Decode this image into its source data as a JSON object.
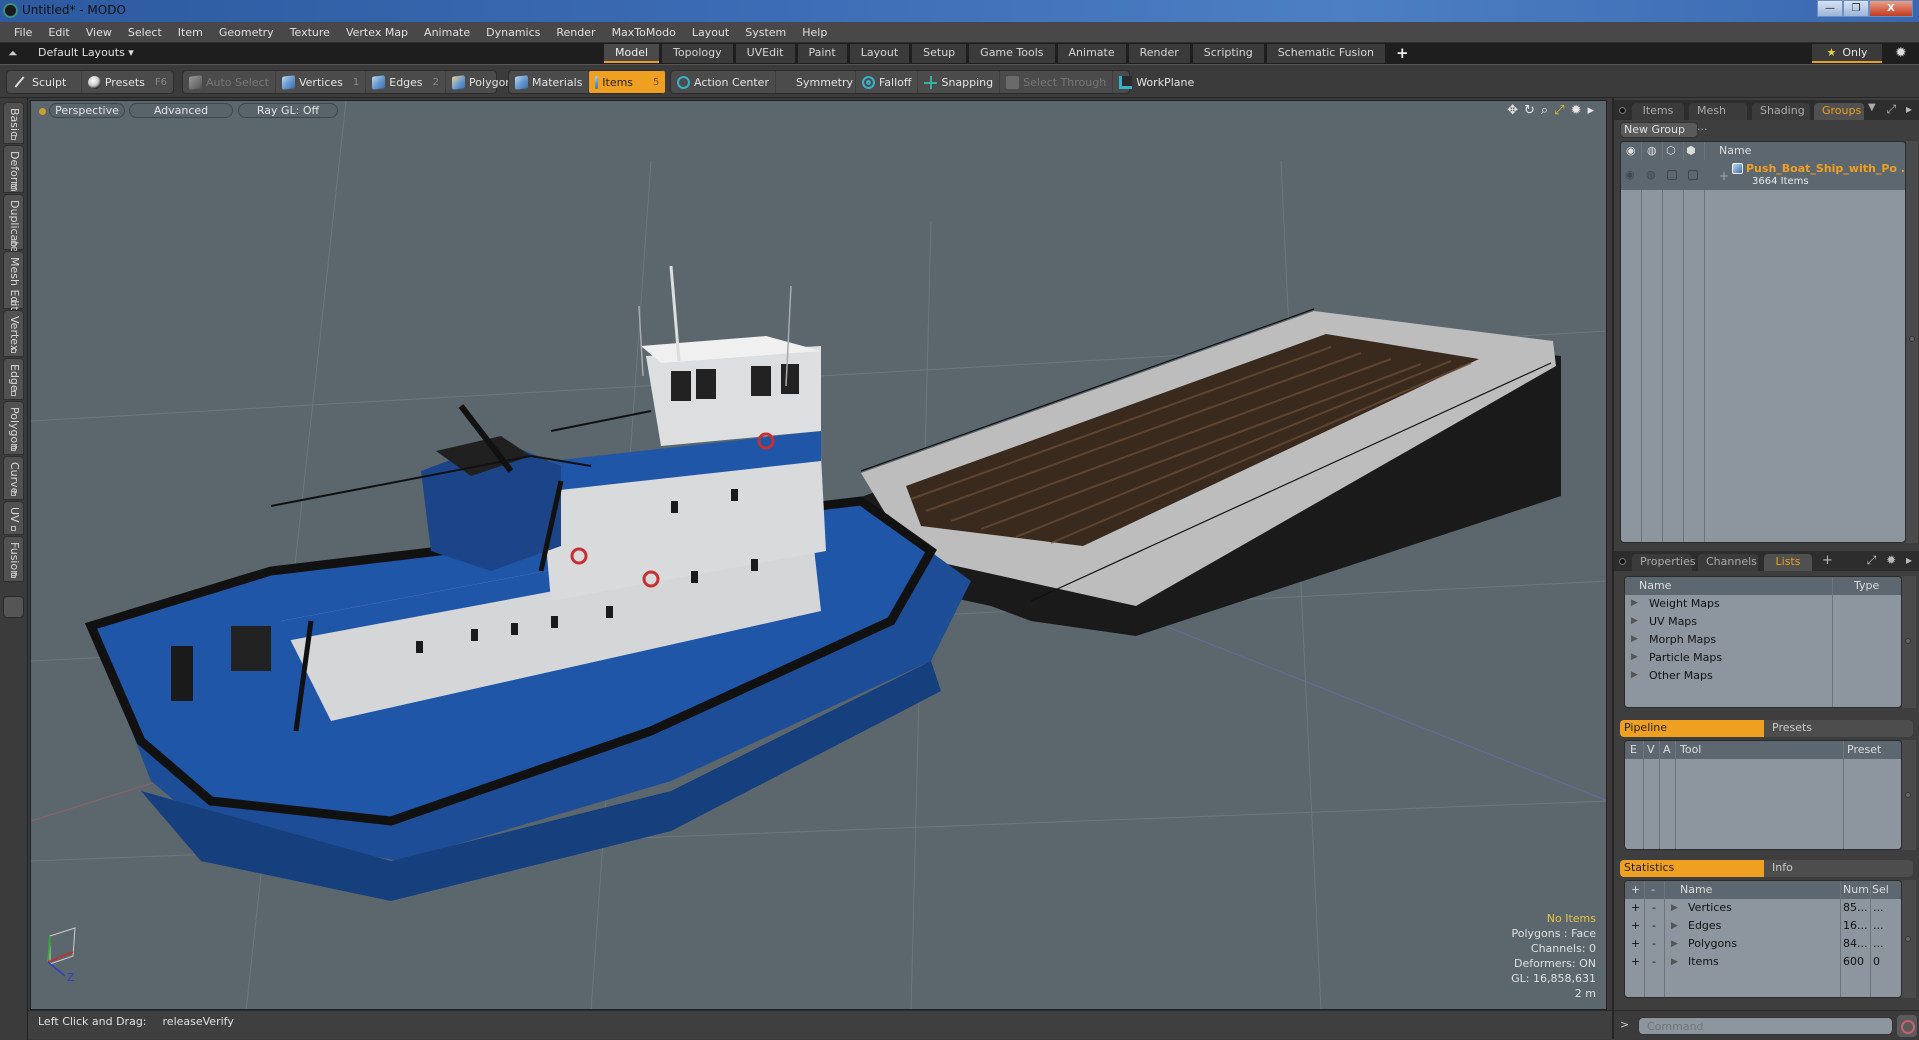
{
  "window": {
    "title": "Untitled* - MODO",
    "controls": [
      "minimize",
      "restore",
      "close"
    ]
  },
  "menubar": {
    "items": [
      "File",
      "Edit",
      "View",
      "Select",
      "Item",
      "Geometry",
      "Texture",
      "Vertex Map",
      "Animate",
      "Dynamics",
      "Render",
      "MaxToModo",
      "Layout",
      "System",
      "Help"
    ]
  },
  "layoutbar": {
    "layouts_dropdown": "Default Layouts ▾",
    "tabs": [
      {
        "label": "Model",
        "active": true
      },
      {
        "label": "Topology"
      },
      {
        "label": "UVEdit"
      },
      {
        "label": "Paint"
      },
      {
        "label": "Layout"
      },
      {
        "label": "Setup"
      },
      {
        "label": "Game Tools"
      },
      {
        "label": "Animate"
      },
      {
        "label": "Render"
      },
      {
        "label": "Scripting"
      },
      {
        "label": "Schematic Fusion"
      }
    ],
    "add_tab": "+",
    "only_label": "Only",
    "only_star": "★"
  },
  "toolbar": {
    "sculpt": "Sculpt",
    "presets": "Presets",
    "presets_key": "F6",
    "auto_select": "Auto Select",
    "vertices": "Vertices",
    "vertices_key": "1",
    "edges": "Edges",
    "edges_key": "2",
    "polygons": "Polygons",
    "materials": "Materials",
    "items": "Items",
    "items_key": "5",
    "action_center": "Action Center",
    "symmetry": "Symmetry",
    "falloff": "Falloff",
    "snapping": "Snapping",
    "select_through": "Select Through",
    "workplane": "WorkPlane",
    "active_mode": "Items"
  },
  "left_tabs": [
    "Basic",
    "Deform",
    "Duplicate",
    "Mesh Edit",
    "Vertex",
    "Edge",
    "Polygon",
    "Curve",
    "UV",
    "Fusion"
  ],
  "viewport": {
    "view": "Perspective",
    "shading": "Advanced",
    "raygl": "Ray GL: Off",
    "info": {
      "selection": "No Items",
      "mode": "Polygons : Face",
      "channels": "Channels: 0",
      "deformers": "Deformers: ON",
      "gl": "GL: 16,858,631",
      "scale": "2 m"
    },
    "axis_label": "Z",
    "scene_description": "Push boat (blue/white tug) with barge loaded with timber"
  },
  "statusbar": {
    "hint_label": "Left Click and Drag:",
    "hint_value": "releaseVerify"
  },
  "right_panel": {
    "top_tabs": [
      {
        "label": "Items"
      },
      {
        "label": "Mesh ..."
      },
      {
        "label": "Shading"
      },
      {
        "label": "Groups",
        "active": true
      }
    ],
    "new_group": "New Group",
    "groups_columns": [
      "Name"
    ],
    "groups": [
      {
        "name": "Push_Boat_Ship_with_Po ...",
        "count": "3664 Items"
      }
    ],
    "mid_tabs": [
      {
        "label": "Properties"
      },
      {
        "label": "Channels"
      },
      {
        "label": "Lists",
        "active": true
      }
    ],
    "lists_columns": [
      "Name",
      "Type"
    ],
    "lists": [
      "Weight Maps",
      "UV Maps",
      "Morph Maps",
      "Particle Maps",
      "Other Maps"
    ],
    "pipeline_tabs": [
      {
        "label": "Pipeline",
        "active": true
      },
      {
        "label": "Presets"
      }
    ],
    "pipeline_columns": [
      "E",
      "V",
      "A",
      "Tool",
      "Preset"
    ],
    "stats_tabs": [
      {
        "label": "Statistics",
        "active": true
      },
      {
        "label": "Info"
      }
    ],
    "stats_columns": [
      "+",
      "-",
      "Name",
      "Num",
      "Sel"
    ],
    "stats": [
      {
        "name": "Vertices",
        "num": "85...",
        "sel": "..."
      },
      {
        "name": "Edges",
        "num": "16...",
        "sel": "..."
      },
      {
        "name": "Polygons",
        "num": "84...",
        "sel": "..."
      },
      {
        "name": "Items",
        "num": "600",
        "sel": "0"
      }
    ],
    "command_prompt": ">",
    "command_placeholder": "Command"
  },
  "colors": {
    "accent": "#f0a020",
    "viewport_bg": "#5b666d",
    "panel_bg": "#3e3e3e",
    "list_bg": "#8d969e",
    "hull_blue": "#1e4f9a",
    "warn_text": "#e8c24a"
  }
}
